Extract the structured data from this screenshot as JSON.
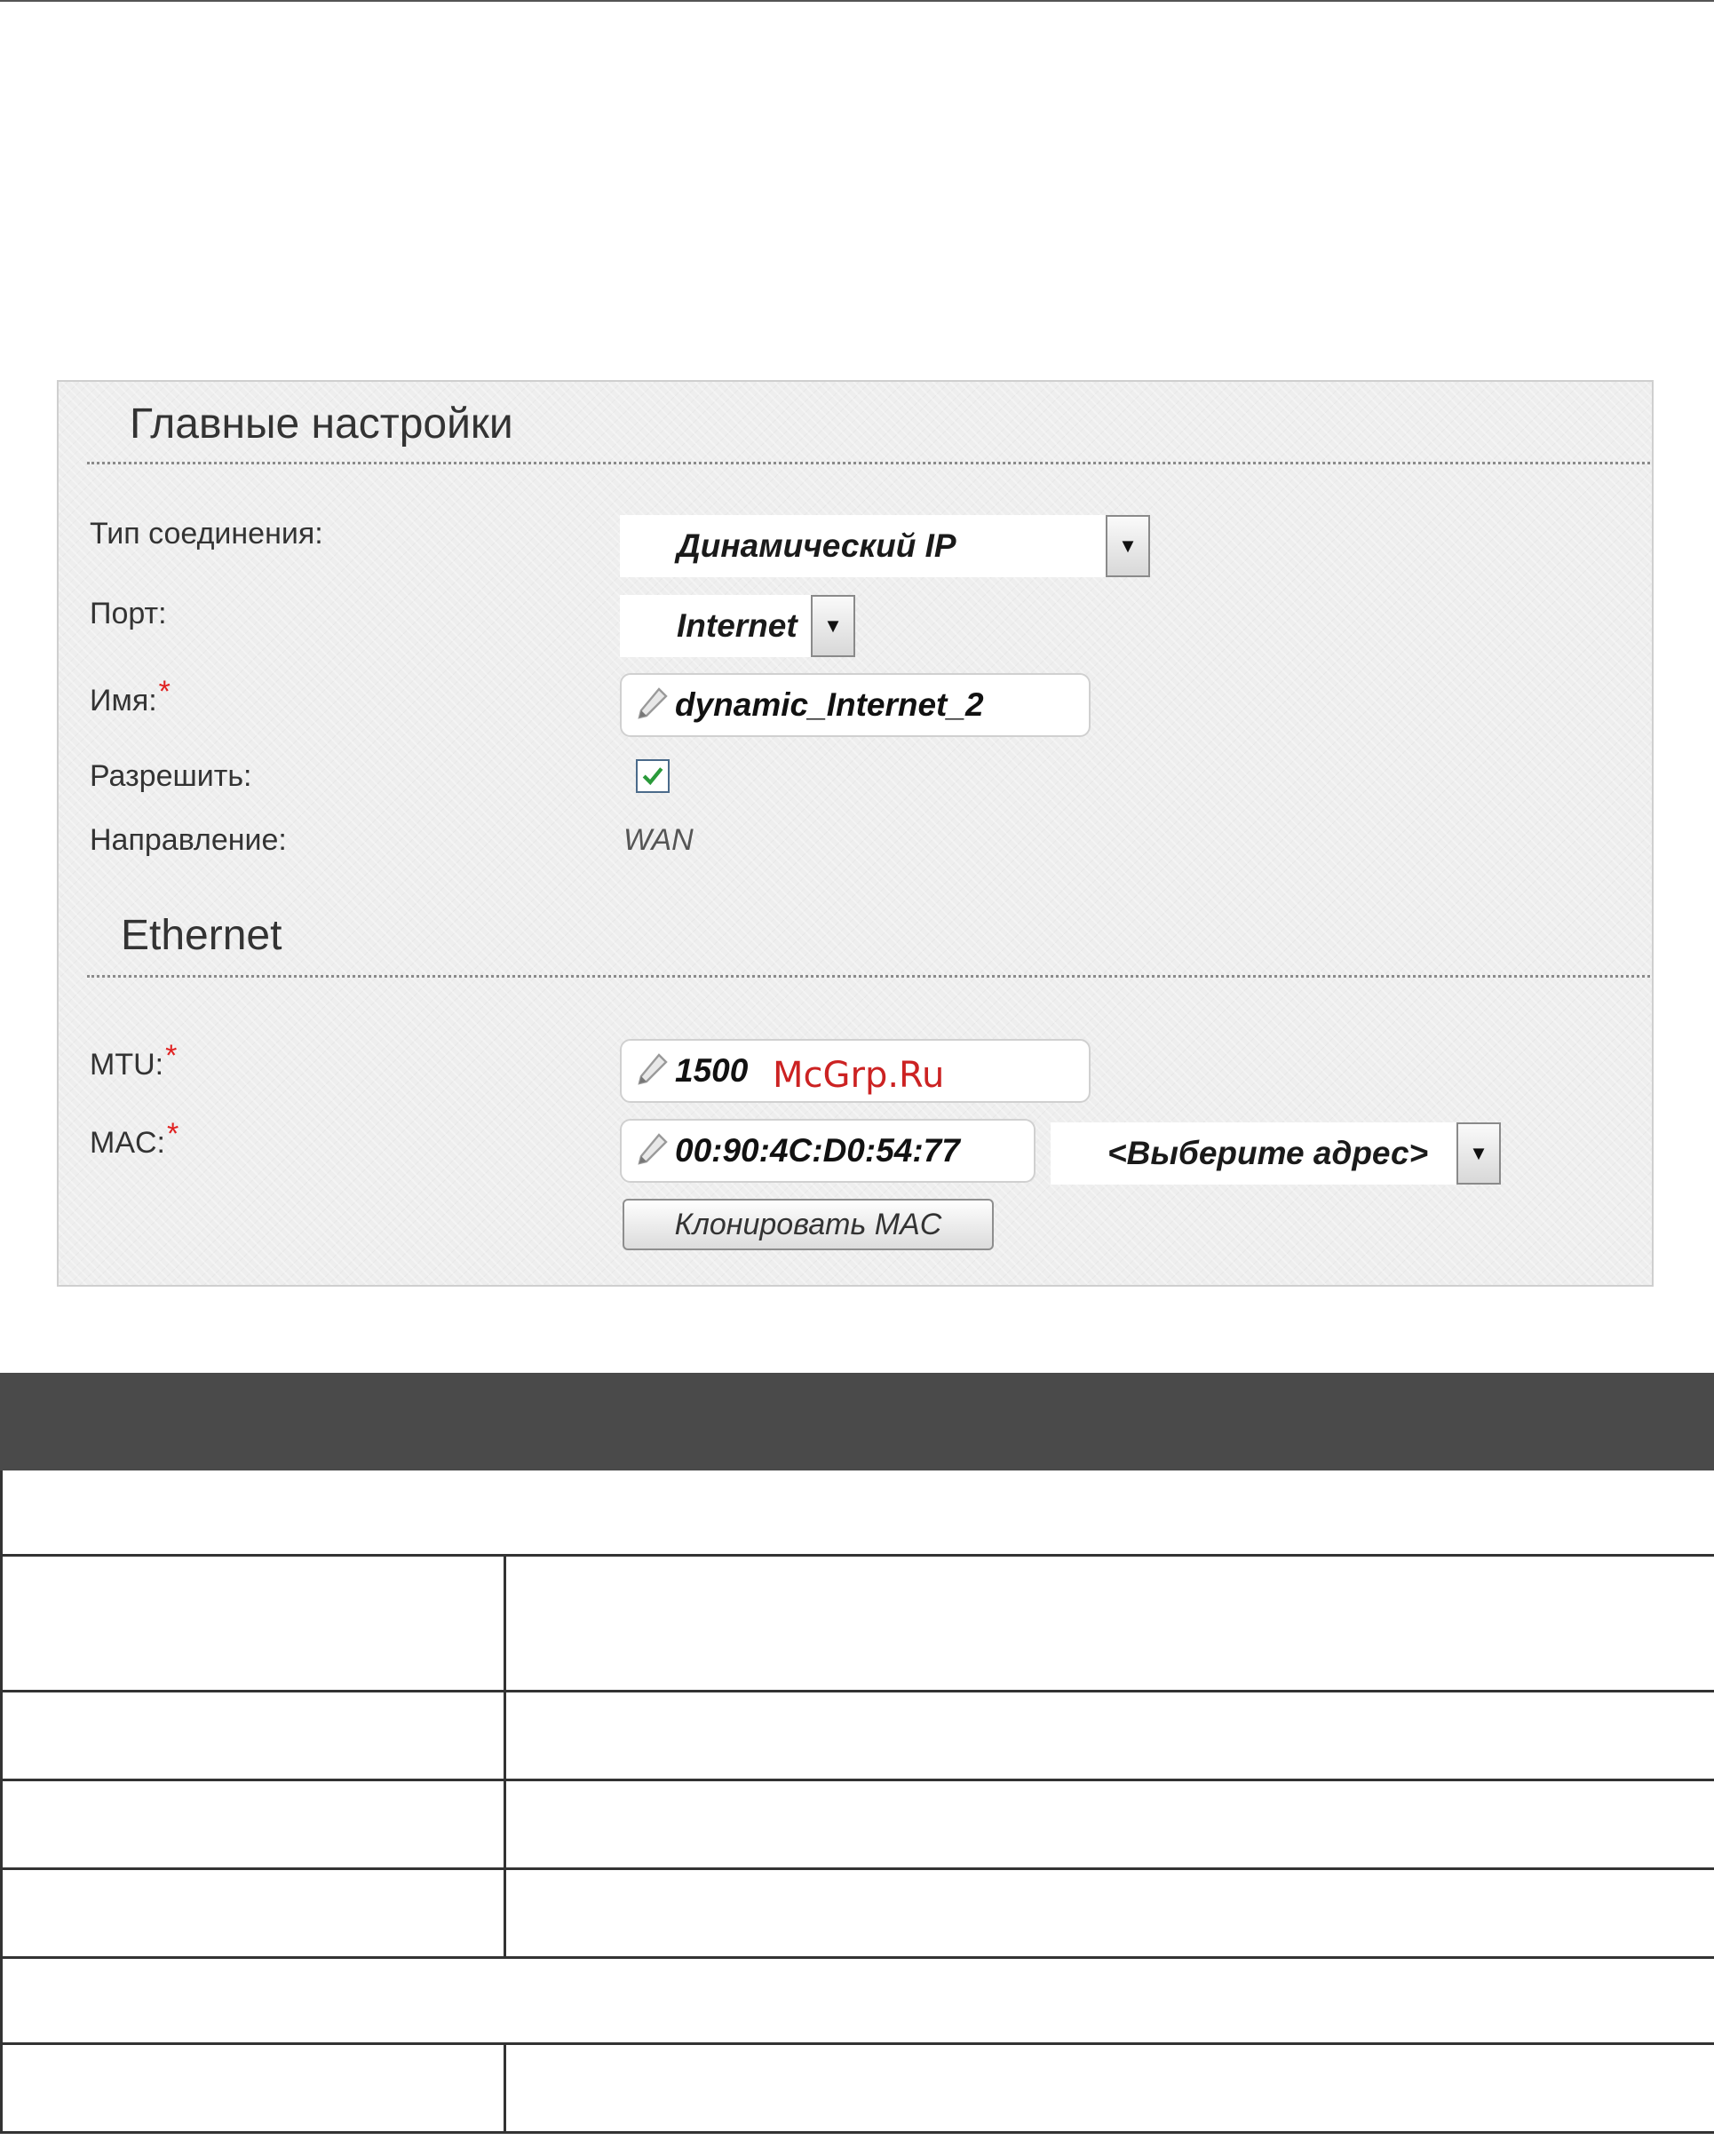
{
  "main_settings": {
    "title": "Главные настройки",
    "connection_type": {
      "label": "Тип соединения:",
      "value": "Динамический IP"
    },
    "port": {
      "label": "Порт:",
      "value": "Internet"
    },
    "name": {
      "label": "Имя:",
      "required_mark": "*",
      "value": "dynamic_Internet_2"
    },
    "enable": {
      "label": "Разрешить:",
      "checked": true
    },
    "direction": {
      "label": "Направление:",
      "value": "WAN"
    }
  },
  "ethernet": {
    "title": "Ethernet",
    "mtu": {
      "label": "MTU:",
      "required_mark": "*",
      "value": "1500"
    },
    "mac": {
      "label": "MAC:",
      "required_mark": "*",
      "value": "00:90:4C:D0:54:77"
    },
    "mac_select": {
      "value": "<Выберите адрес>"
    },
    "clone_mac_button": "Клонировать MAC"
  },
  "watermark": "McGrp.Ru",
  "colors": {
    "required": "#e02020",
    "table_header": "#4a4a4a",
    "checkbox_check": "#2a9a3a"
  },
  "icons": [
    "pencil-icon",
    "chevron-down-icon",
    "checkmark-icon"
  ]
}
